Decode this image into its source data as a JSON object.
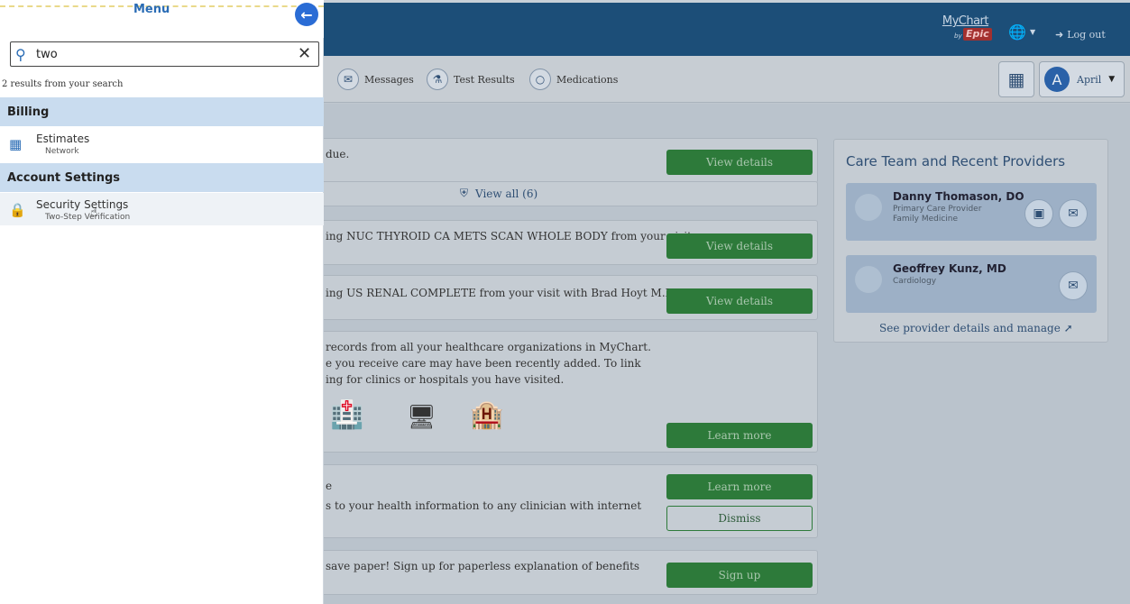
{
  "header": {
    "logo_main": "MyChart",
    "logo_by": "by",
    "logo_epic": "Epic",
    "language_icon": "globe-icon",
    "logout_label": "Log out"
  },
  "nav": {
    "items": [
      {
        "label": "Messages",
        "icon": "envelope-icon"
      },
      {
        "label": "Test Results",
        "icon": "flask-icon"
      },
      {
        "label": "Medications",
        "icon": "pill-icon"
      }
    ],
    "user_initial": "A",
    "user_name": "April"
  },
  "main": {
    "card1_text": "due.",
    "card1_button": "View details",
    "viewall_label": "View all (6)",
    "card2_text": "ing NUC THYROID CA METS SCAN WHOLE BODY from your visit",
    "card2_button": "View details",
    "card3_text": "ing US RENAL COMPLETE from your visit with Brad Hoyt M.D..",
    "card3_button": "View details",
    "card4_line1": "records from all your healthcare organizations in MyChart.",
    "card4_line2": "e you receive care may have been recently added. To link",
    "card4_line3": "ing for clinics or hospitals you have visited.",
    "card4_button": "Learn more",
    "card5_title": "e",
    "card5_text": "s to your health information to any clinician with internet",
    "card5_button": "Learn more",
    "card5_dismiss": "Dismiss",
    "card6_text": "save paper! Sign up for paperless explanation of benefits",
    "card6_button": "Sign up"
  },
  "care_team": {
    "title": "Care Team and Recent Providers",
    "providers": [
      {
        "name": "Danny Thomason, DO",
        "role1": "Primary Care Provider",
        "role2": "Family Medicine"
      },
      {
        "name": "Geoffrey Kunz, MD",
        "role1": "Cardiology",
        "role2": ""
      }
    ],
    "see_details": "See provider details and manage"
  },
  "menu": {
    "title": "Menu",
    "search_value": "two",
    "results_note": "2 results from your search",
    "sections": [
      {
        "heading": "Billing",
        "items": [
          {
            "title": "Estimates",
            "sub": "Network"
          }
        ]
      },
      {
        "heading": "Account Settings",
        "items": [
          {
            "title": "Security Settings",
            "sub": "Two-Step Verification"
          }
        ]
      }
    ]
  },
  "colors": {
    "menu_accent": "#2a6cb5",
    "section_bg": "#c9dcef",
    "header_bg": "#1c4e78",
    "button_green": "#2d7a3a"
  }
}
